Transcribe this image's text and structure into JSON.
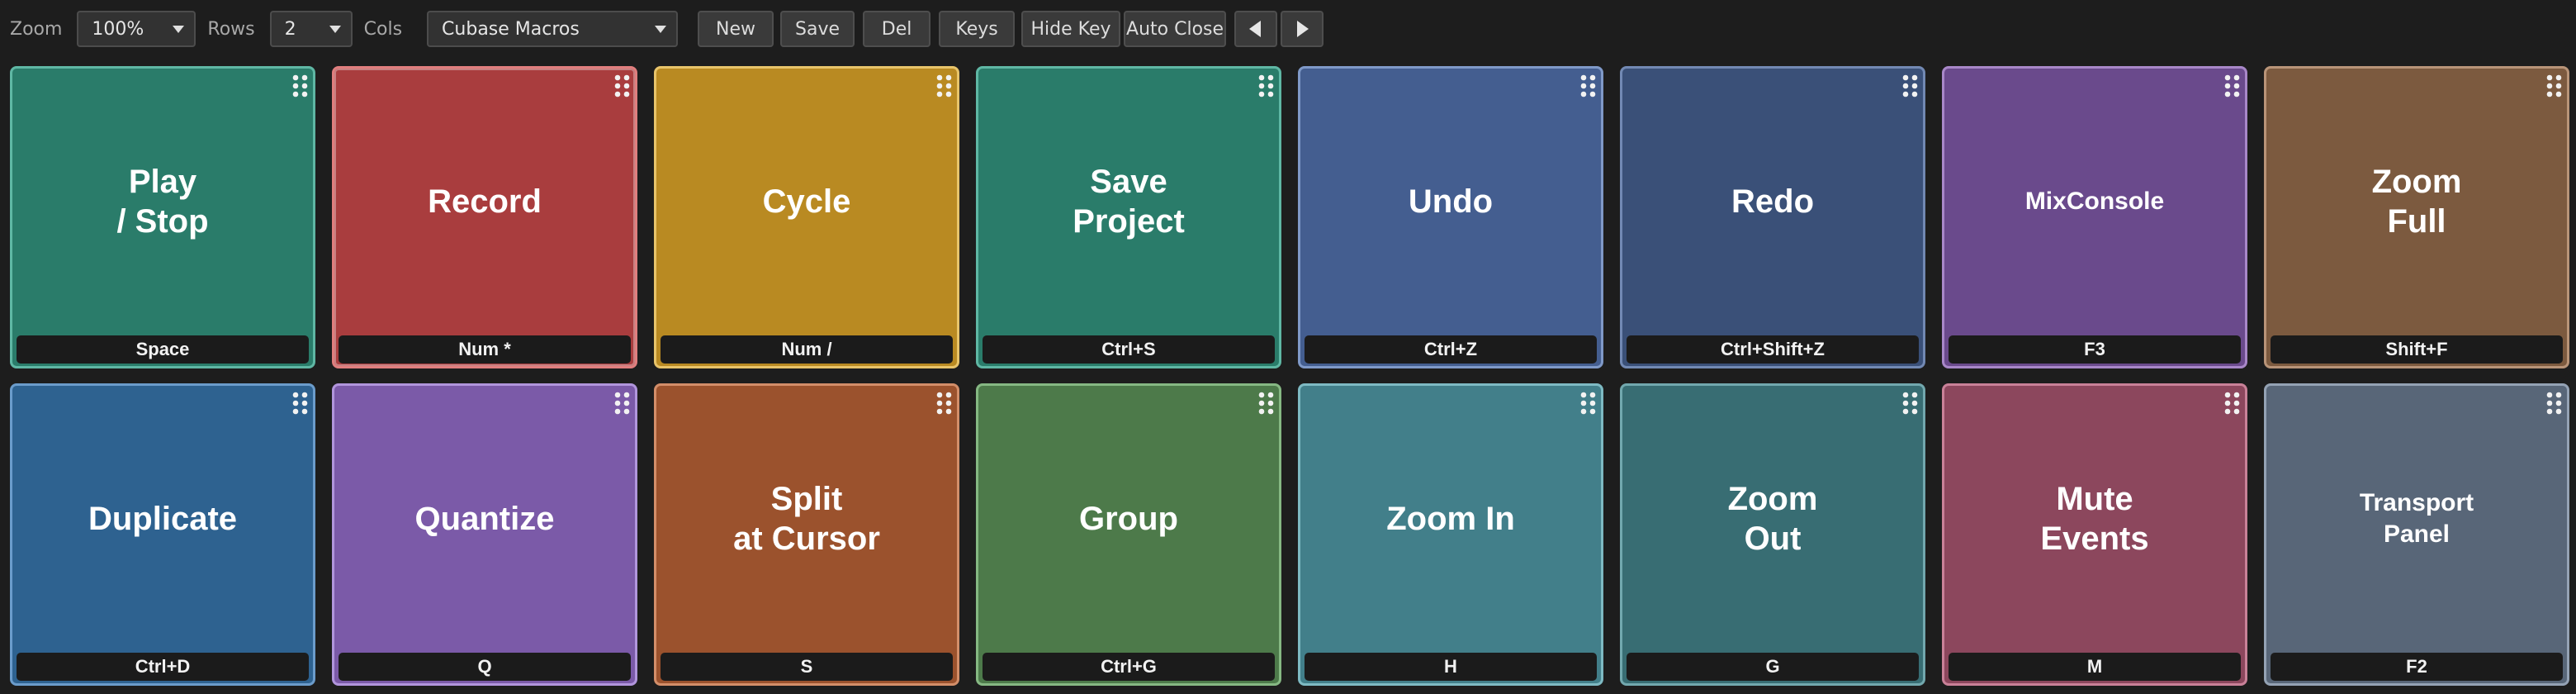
{
  "toolbar": {
    "zoom_label": "Zoom",
    "zoom_value": "100%",
    "rows_label": "Rows",
    "rows_value": "2",
    "cols_label": "Cols",
    "preset_value": "Cubase Macros",
    "new_label": "New",
    "save_label": "Save",
    "del_label": "Del",
    "keys_label": "Keys",
    "hide_key_label": "Hide Key",
    "auto_close_label": "Auto Close",
    "prev_icon": "triangle-left-icon",
    "next_icon": "triangle-right-icon"
  },
  "pads": [
    {
      "label": "Play\n/ Stop",
      "key": "Space",
      "color": "#2a7c6a",
      "border": "#5fb7a4"
    },
    {
      "label": "Record",
      "key": "Num *",
      "color": "#a93d3e",
      "border": "#e07e7e",
      "selected": true
    },
    {
      "label": "Cycle",
      "key": "Num /",
      "color": "#b98a22",
      "border": "#e8c46a"
    },
    {
      "label": "Save\nProject",
      "key": "Ctrl+S",
      "color": "#2a7c6a",
      "border": "#5fb7a4"
    },
    {
      "label": "Undo",
      "key": "Ctrl+Z",
      "color": "#445e90",
      "border": "#7f99c8"
    },
    {
      "label": "Redo",
      "key": "Ctrl+Shift+Z",
      "color": "#3a5078",
      "border": "#7289b3"
    },
    {
      "label": "MixConsole",
      "key": "F3",
      "color": "#6a4a8c",
      "border": "#a887c8",
      "small": true
    },
    {
      "label": "Zoom\nFull",
      "key": "Shift+F",
      "color": "#7c5a3f",
      "border": "#b89478"
    },
    {
      "label": "Duplicate",
      "key": "Ctrl+D",
      "color": "#2e6290",
      "border": "#6b9ccb"
    },
    {
      "label": "Quantize",
      "key": "Q",
      "color": "#7b5aa8",
      "border": "#b195dc"
    },
    {
      "label": "Split\nat Cursor",
      "key": "S",
      "color": "#9b522d",
      "border": "#d38e69"
    },
    {
      "label": "Group",
      "key": "Ctrl+G",
      "color": "#4d7a4a",
      "border": "#86b883"
    },
    {
      "label": "Zoom In",
      "key": "H",
      "color": "#427f8a",
      "border": "#7ebac3"
    },
    {
      "label": "Zoom\nOut",
      "key": "G",
      "color": "#386d73",
      "border": "#72a8ae"
    },
    {
      "label": "Mute\nEvents",
      "key": "M",
      "color": "#8c475d",
      "border": "#c98198"
    },
    {
      "label": "Transport\nPanel",
      "key": "F2",
      "color": "#586678",
      "border": "#94a2b4",
      "small": true
    }
  ]
}
